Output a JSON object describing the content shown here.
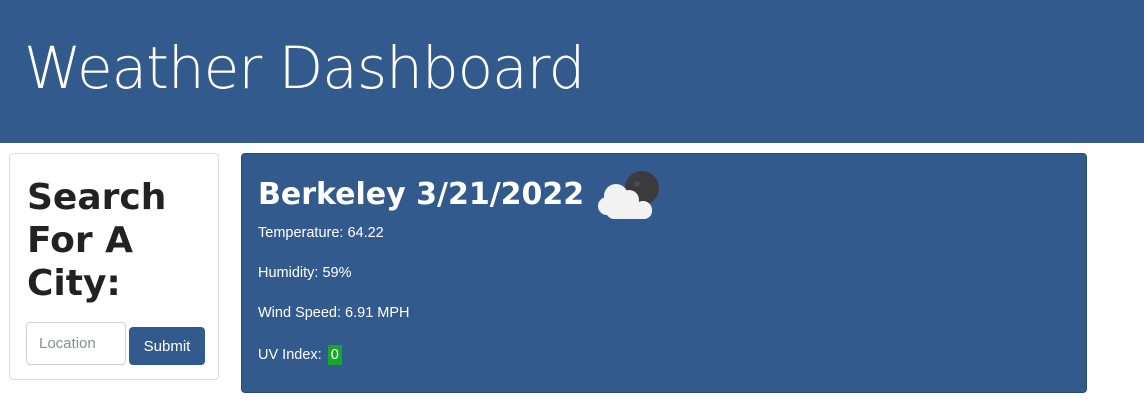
{
  "header": {
    "title": "Weather Dashboard"
  },
  "search": {
    "title": "Search For A City:",
    "placeholder": "Location",
    "value": "",
    "submit_label": "Submit"
  },
  "current": {
    "heading": "Berkeley 3/21/2022",
    "icon": "partly-cloudy-night-icon",
    "temperature_label": "Temperature: 64.22",
    "humidity_label": "Humidity: 59%",
    "wind_label": "Wind Speed: 6.91 MPH",
    "uv_label": "UV Index:",
    "uv_value": "0",
    "uv_color": "#15a82b"
  },
  "colors": {
    "primary": "#325a8c"
  }
}
